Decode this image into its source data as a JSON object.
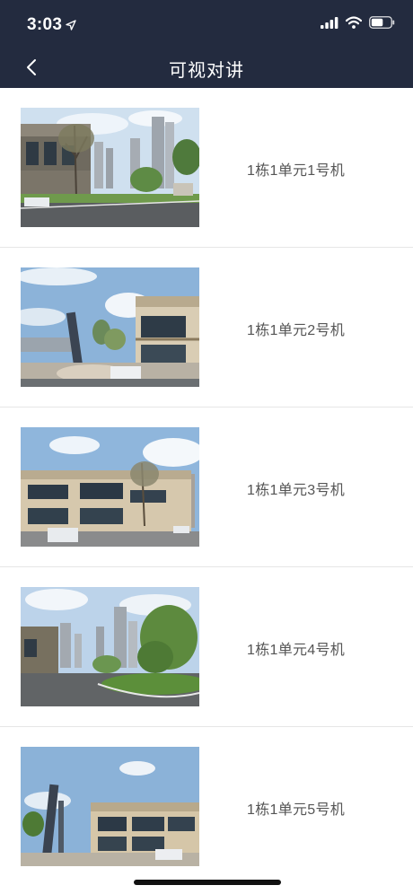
{
  "status_bar": {
    "time": "3:03",
    "icons": [
      "location-arrow-icon",
      "cellular-signal-icon",
      "wifi-icon",
      "battery-icon"
    ]
  },
  "nav": {
    "title": "可视对讲",
    "back_icon": "chevron-left-icon"
  },
  "devices": [
    {
      "label": "1栋1单元1号机",
      "thumbnail": "building-photo-1"
    },
    {
      "label": "1栋1单元2号机",
      "thumbnail": "building-photo-2"
    },
    {
      "label": "1栋1单元3号机",
      "thumbnail": "building-photo-3"
    },
    {
      "label": "1栋1单元4号机",
      "thumbnail": "building-photo-4"
    },
    {
      "label": "1栋1单元5号机",
      "thumbnail": "building-photo-5"
    }
  ],
  "colors": {
    "header_bg": "#232b3f",
    "label_text": "#555555",
    "divider": "#e6e6e6"
  }
}
